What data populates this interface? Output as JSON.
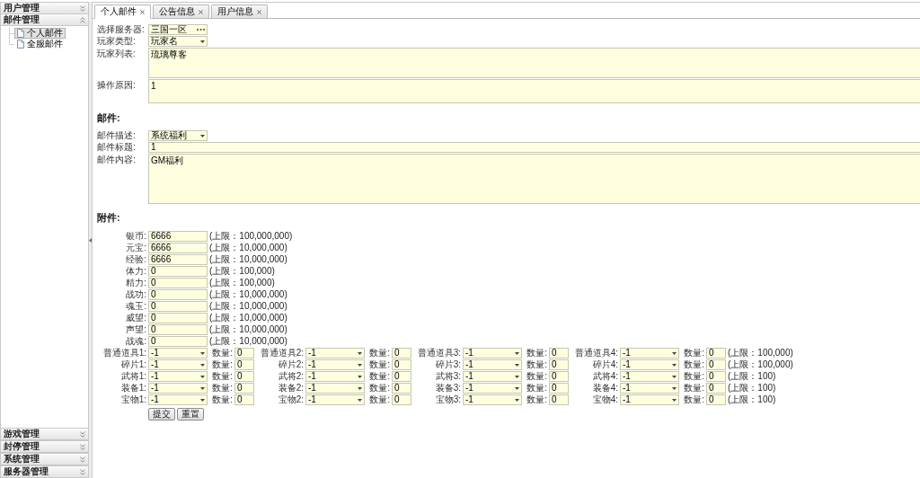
{
  "sidebar": {
    "top_panels": [
      {
        "title": "用户管理",
        "expanded": false
      },
      {
        "title": "邮件管理",
        "expanded": true,
        "items": [
          {
            "label": "个人邮件",
            "selected": true
          },
          {
            "label": "全服邮件",
            "selected": false
          }
        ]
      }
    ],
    "bottom_panels": [
      {
        "title": "游戏管理",
        "expanded": false
      },
      {
        "title": "封停管理",
        "expanded": false
      },
      {
        "title": "系统管理",
        "expanded": false
      },
      {
        "title": "服务器管理",
        "expanded": false
      }
    ]
  },
  "tabs": [
    {
      "label": "个人邮件",
      "selected": true
    },
    {
      "label": "公告信息",
      "selected": false
    },
    {
      "label": "用户信息",
      "selected": false
    }
  ],
  "form": {
    "fields": [
      {
        "label": "选择服务器:",
        "kind": "picker",
        "value": "三国一区"
      },
      {
        "label": "玩家类型:",
        "kind": "select",
        "value": "玩家名"
      },
      {
        "label": "玩家列表:",
        "kind": "textarea",
        "value": "琉璃尊客"
      },
      {
        "label": "操作原因:",
        "kind": "textarea",
        "value": "1"
      }
    ]
  },
  "mail": {
    "heading": "邮件:",
    "fields": [
      {
        "label": "邮件描述:",
        "kind": "select",
        "value": "系统福利"
      },
      {
        "label": "邮件标题:",
        "kind": "text",
        "value": "1"
      },
      {
        "label": "邮件内容:",
        "kind": "textarea",
        "value": "GM福利"
      }
    ]
  },
  "attachments": {
    "heading": "附件:",
    "resources": [
      {
        "label": "银币:",
        "value": "6666",
        "limit": "(上限：100,000,000)"
      },
      {
        "label": "元宝:",
        "value": "6666",
        "limit": "(上限：10,000,000)"
      },
      {
        "label": "经验:",
        "value": "6666",
        "limit": "(上限：10,000,000)"
      },
      {
        "label": "体力:",
        "value": "0",
        "limit": "(上限：100,000)"
      },
      {
        "label": "精力:",
        "value": "0",
        "limit": "(上限：100,000)"
      },
      {
        "label": "战功:",
        "value": "0",
        "limit": "(上限：10,000,000)"
      },
      {
        "label": "魂玉:",
        "value": "0",
        "limit": "(上限：10,000,000)"
      },
      {
        "label": "威望:",
        "value": "0",
        "limit": "(上限：10,000,000)"
      },
      {
        "label": "声望:",
        "value": "0",
        "limit": "(上限：10,000,000)"
      },
      {
        "label": "战魂:",
        "value": "0",
        "limit": "(上限：10,000,000)"
      }
    ],
    "item_rows": [
      {
        "cells": [
          {
            "label": "普通道具1:",
            "value": "-1",
            "qty_label": "数量:",
            "qty": "0"
          },
          {
            "label": "普通道具2:",
            "value": "-1",
            "qty_label": "数量:",
            "qty": "0"
          },
          {
            "label": "普通道具3:",
            "value": "-1",
            "qty_label": "数量:",
            "qty": "0"
          },
          {
            "label": "普通道具4:",
            "value": "-1",
            "qty_label": "数量:",
            "qty": "0"
          }
        ],
        "limit": "(上限：100,000)"
      },
      {
        "cells": [
          {
            "label": "碎片1:",
            "value": "-1",
            "qty_label": "数量:",
            "qty": "0"
          },
          {
            "label": "碎片2:",
            "value": "-1",
            "qty_label": "数量:",
            "qty": "0"
          },
          {
            "label": "碎片3:",
            "value": "-1",
            "qty_label": "数量:",
            "qty": "0"
          },
          {
            "label": "碎片4:",
            "value": "-1",
            "qty_label": "数量:",
            "qty": "0"
          }
        ],
        "limit": "(上限：100,000)"
      },
      {
        "cells": [
          {
            "label": "武将1:",
            "value": "-1",
            "qty_label": "数量:",
            "qty": "0"
          },
          {
            "label": "武将2:",
            "value": "-1",
            "qty_label": "数量:",
            "qty": "0"
          },
          {
            "label": "武将3:",
            "value": "-1",
            "qty_label": "数量:",
            "qty": "0"
          },
          {
            "label": "武将4:",
            "value": "-1",
            "qty_label": "数量:",
            "qty": "0"
          }
        ],
        "limit": "(上限：100)"
      },
      {
        "cells": [
          {
            "label": "装备1:",
            "value": "-1",
            "qty_label": "数量:",
            "qty": "0"
          },
          {
            "label": "装备2:",
            "value": "-1",
            "qty_label": "数量:",
            "qty": "0"
          },
          {
            "label": "装备3:",
            "value": "-1",
            "qty_label": "数量:",
            "qty": "0"
          },
          {
            "label": "装备4:",
            "value": "-1",
            "qty_label": "数量:",
            "qty": "0"
          }
        ],
        "limit": "(上限：100)"
      },
      {
        "cells": [
          {
            "label": "宝物1:",
            "value": "-1",
            "qty_label": "数量:",
            "qty": "0"
          },
          {
            "label": "宝物2:",
            "value": "-1",
            "qty_label": "数量:",
            "qty": "0"
          },
          {
            "label": "宝物3:",
            "value": "-1",
            "qty_label": "数量:",
            "qty": "0"
          },
          {
            "label": "宝物4:",
            "value": "-1",
            "qty_label": "数量:",
            "qty": "0"
          }
        ],
        "limit": "(上限：100)"
      }
    ]
  },
  "buttons": [
    {
      "label": "提交"
    },
    {
      "label": "重置"
    }
  ]
}
